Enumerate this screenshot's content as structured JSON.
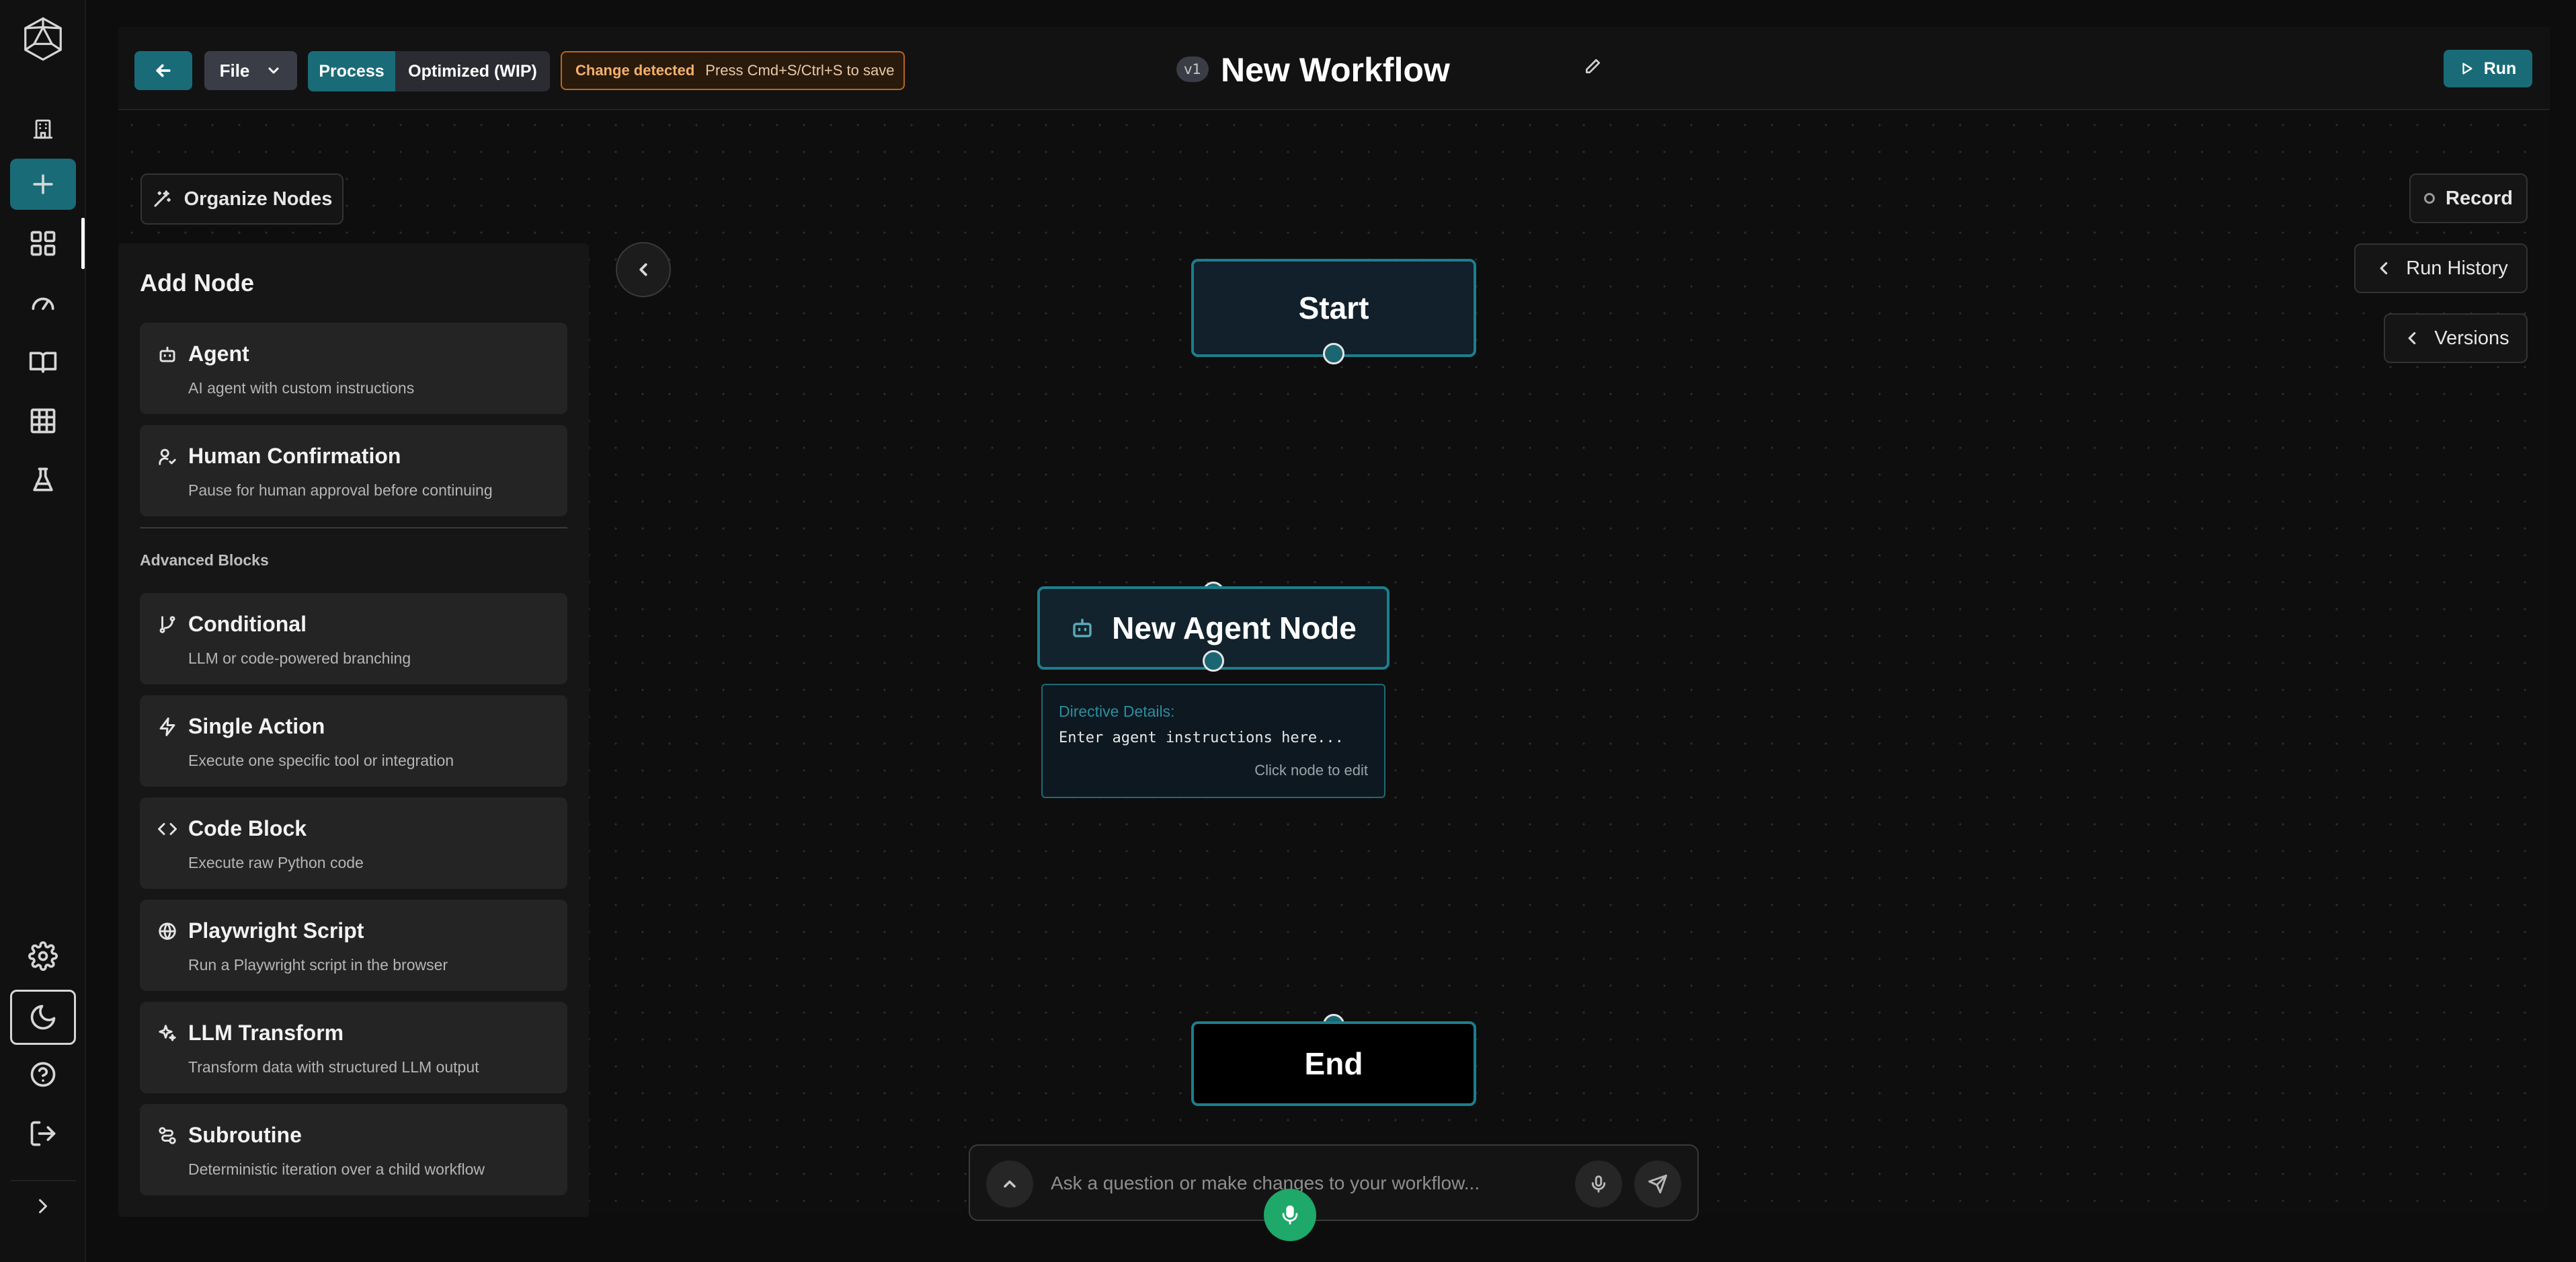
{
  "rail": {
    "items": [
      {
        "icon": "logo-icon"
      },
      {
        "icon": "building-icon"
      },
      {
        "icon": "plus-icon"
      },
      {
        "icon": "grid-icon"
      },
      {
        "icon": "gauge-icon"
      },
      {
        "icon": "book-icon"
      },
      {
        "icon": "table-icon"
      },
      {
        "icon": "flask-icon"
      },
      {
        "icon": "gear-icon"
      },
      {
        "icon": "moon-icon"
      },
      {
        "icon": "help-icon"
      },
      {
        "icon": "logout-icon"
      },
      {
        "icon": "chevron-right-icon"
      }
    ]
  },
  "topbar": {
    "file_label": "File",
    "mode_process": "Process",
    "mode_optimized": "Optimized (WIP)",
    "change_title": "Change detected",
    "change_hint": "Press Cmd+S/Ctrl+S to save",
    "version_badge": "v1",
    "workflow_title": "New Workflow",
    "run_label": "Run"
  },
  "canvas": {
    "organize_label": "Organize Nodes",
    "record_label": "Record",
    "run_history_label": "Run History",
    "versions_label": "Versions"
  },
  "panel": {
    "title": "Add Node",
    "basic": [
      {
        "icon": "robot-icon",
        "title": "Agent",
        "desc": "AI agent with custom instructions"
      },
      {
        "icon": "user-check-icon",
        "title": "Human Confirmation",
        "desc": "Pause for human approval before continuing"
      }
    ],
    "advanced_label": "Advanced Blocks",
    "advanced": [
      {
        "icon": "branch-icon",
        "title": "Conditional",
        "desc": "LLM or code-powered branching"
      },
      {
        "icon": "bolt-icon",
        "title": "Single Action",
        "desc": "Execute one specific tool or integration"
      },
      {
        "icon": "code-icon",
        "title": "Code Block",
        "desc": "Execute raw Python code"
      },
      {
        "icon": "globe-icon",
        "title": "Playwright Script",
        "desc": "Run a Playwright script in the browser"
      },
      {
        "icon": "sparkles-icon",
        "title": "LLM Transform",
        "desc": "Transform data with structured LLM output"
      },
      {
        "icon": "route-icon",
        "title": "Subroutine",
        "desc": "Deterministic iteration over a child workflow"
      }
    ]
  },
  "nodes": {
    "start": "Start",
    "agent": "New Agent Node",
    "end": "End",
    "directive_label": "Directive Details:",
    "directive_text": "Enter agent instructions here...",
    "directive_hint": "Click node to edit"
  },
  "chat": {
    "placeholder": "Ask a question or make changes to your workflow..."
  },
  "colors": {
    "accent": "#1a6b78",
    "node_border": "#1d7e8c",
    "warning": "#b8651f",
    "voice": "#1ea86a"
  }
}
